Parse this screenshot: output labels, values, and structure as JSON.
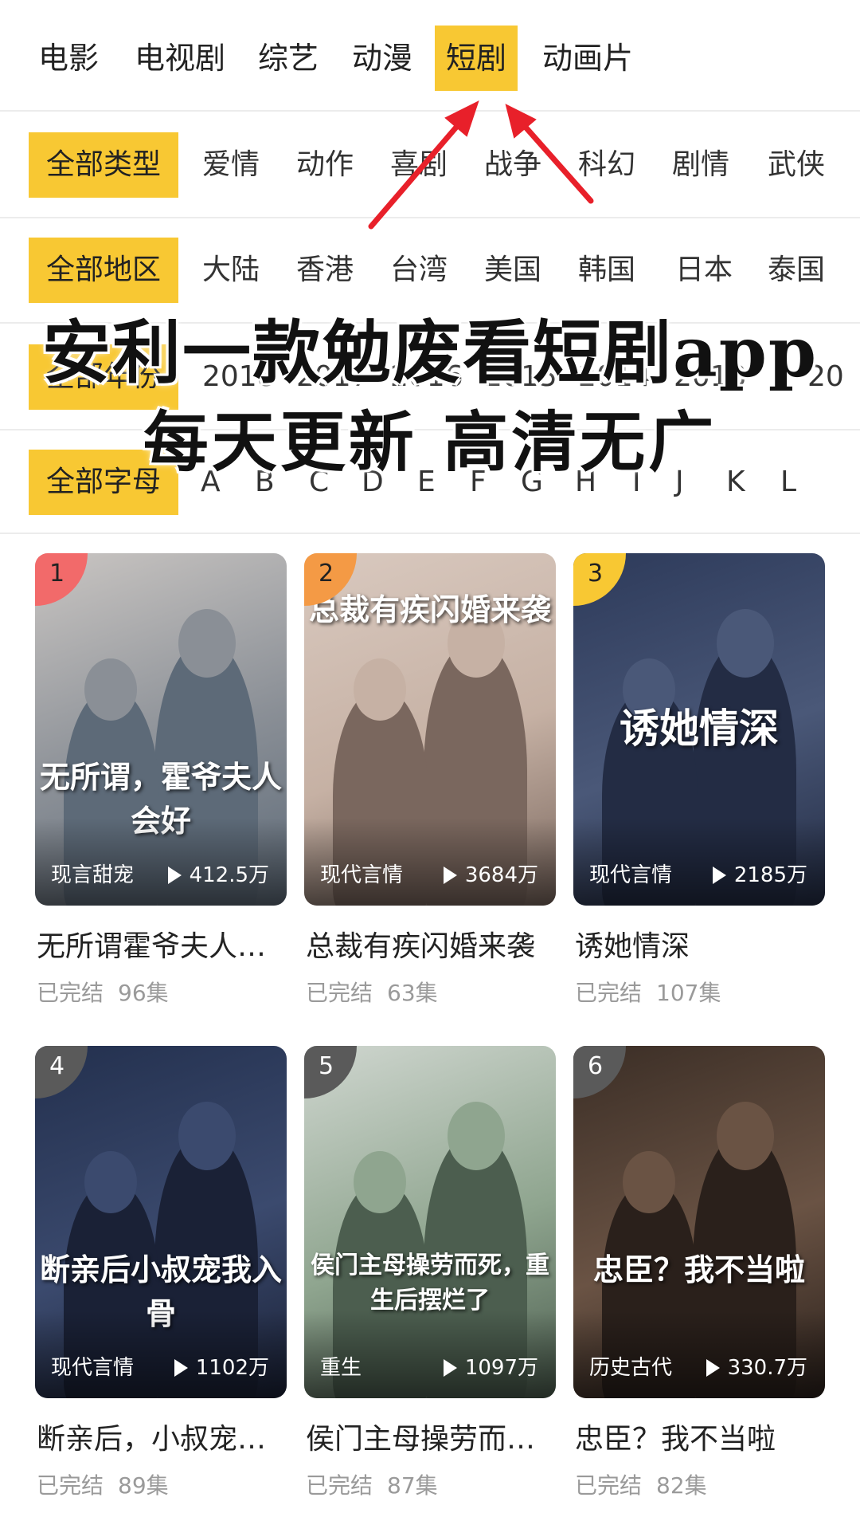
{
  "categories": {
    "items": [
      "电影",
      "电视剧",
      "综艺",
      "动漫",
      "短剧",
      "动画片"
    ],
    "active": "短剧"
  },
  "filters": {
    "type": {
      "label": "全部类型",
      "options": [
        "爱情",
        "动作",
        "喜剧",
        "战争",
        "科幻",
        "剧情",
        "武侠"
      ]
    },
    "region": {
      "label": "全部地区",
      "options": [
        "大陆",
        "香港",
        "台湾",
        "美国",
        "韩国",
        "日本",
        "泰国"
      ]
    },
    "year": {
      "label": "全部年份",
      "options": [
        "2018",
        "2017",
        "2016",
        "2015",
        "2014",
        "2013",
        "20"
      ]
    },
    "letter": {
      "label": "全部字母",
      "options": [
        "A",
        "B",
        "C",
        "D",
        "E",
        "F",
        "G",
        "H",
        "I",
        "J",
        "K",
        "L"
      ]
    }
  },
  "promo": {
    "line1": "安利一款勉废看短剧app",
    "line2": "每天更新 高清无广"
  },
  "cards": [
    {
      "rank": "1",
      "rank_color": "#f26a6a",
      "poster_text": "无所谓，霍爷夫人会好",
      "genre": "现言甜宠",
      "plays": "412.5万",
      "title": "无所谓霍爷夫人…",
      "status": "已完结",
      "episodes": "96集",
      "bg": [
        "#c9c5c2",
        "#8a8f96",
        "#5d6a78"
      ]
    },
    {
      "rank": "2",
      "rank_color": "#f49a45",
      "poster_text": "总裁有疾闪婚来袭",
      "genre": "现代言情",
      "plays": "3684万",
      "title": "总裁有疾闪婚来袭",
      "status": "已完结",
      "episodes": "63集",
      "bg": [
        "#d9c9bf",
        "#c6b1a4",
        "#7a675e"
      ]
    },
    {
      "rank": "3",
      "rank_color": "#f8c833",
      "poster_text": "诱她情深",
      "genre": "现代言情",
      "plays": "2185万",
      "title": "诱她情深",
      "status": "已完结",
      "episodes": "107集",
      "bg": [
        "#2d3a5a",
        "#4a5878",
        "#232c44"
      ]
    },
    {
      "rank": "4",
      "rank_color": "#5a5a5a",
      "poster_text": "断亲后小叔宠我入骨",
      "genre": "现代言情",
      "plays": "1102万",
      "title": "断亲后，小叔宠…",
      "status": "已完结",
      "episodes": "89集",
      "bg": [
        "#23304e",
        "#3b4a6e",
        "#1a2136"
      ]
    },
    {
      "rank": "5",
      "rank_color": "#5a5a5a",
      "poster_text": "侯门主母操劳而死，重生后摆烂了",
      "genre": "重生",
      "plays": "1097万",
      "title": "侯门主母操劳而…",
      "status": "已完结",
      "episodes": "87集",
      "bg": [
        "#cfd6cf",
        "#8fa58f",
        "#4c5e4f"
      ]
    },
    {
      "rank": "6",
      "rank_color": "#5a5a5a",
      "poster_text": "忠臣？我不当啦",
      "genre": "历史古代",
      "plays": "330.7万",
      "title": "忠臣？我不当啦",
      "status": "已完结",
      "episodes": "82集",
      "bg": [
        "#3b2e26",
        "#6a5344",
        "#2a201b"
      ]
    }
  ]
}
